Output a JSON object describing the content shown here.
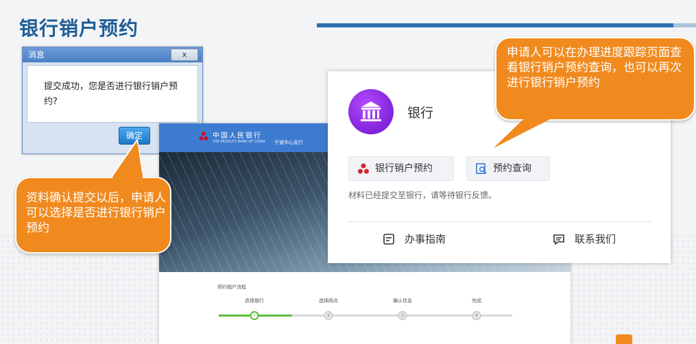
{
  "slide_title": "银行销户预约",
  "dialog": {
    "title": "消息",
    "close_label": "x",
    "message": "提交成功，您是否进行银行销户预约?",
    "ok_label": "确定"
  },
  "website": {
    "logo_cn": "中国人民银行",
    "logo_en": "THE PEOPLE'S BANK OF CHINA",
    "branch": "宁波中心支行",
    "steps_title": "预约销户流程",
    "steps": [
      {
        "label": "选择银行",
        "num": "1",
        "done": true
      },
      {
        "label": "选择网点",
        "num": "2",
        "done": false
      },
      {
        "label": "确认信息",
        "num": "3",
        "done": false
      },
      {
        "label": "完成",
        "num": "4",
        "done": false
      }
    ]
  },
  "card": {
    "bank_name": "银行",
    "cancel_appointment_label": "银行销户预约",
    "query_label": "预约查询",
    "status_note": "材料已经提交至银行，请等待银行反馈。",
    "guide_label": "办事指南",
    "contact_label": "联系我们"
  },
  "callouts": {
    "left": "资料确认提交以后，申请人可以选择是否进行银行销户预约",
    "right": "申请人可以在办理进度跟踪页面查看银行销户预约查询，也可以再次进行银行销户预约"
  },
  "colors": {
    "title_blue": "#1f5d96",
    "callout_orange": "#f08a1e",
    "bank_purple": "#7a1fd6",
    "progress_green": "#5bbf3a"
  }
}
